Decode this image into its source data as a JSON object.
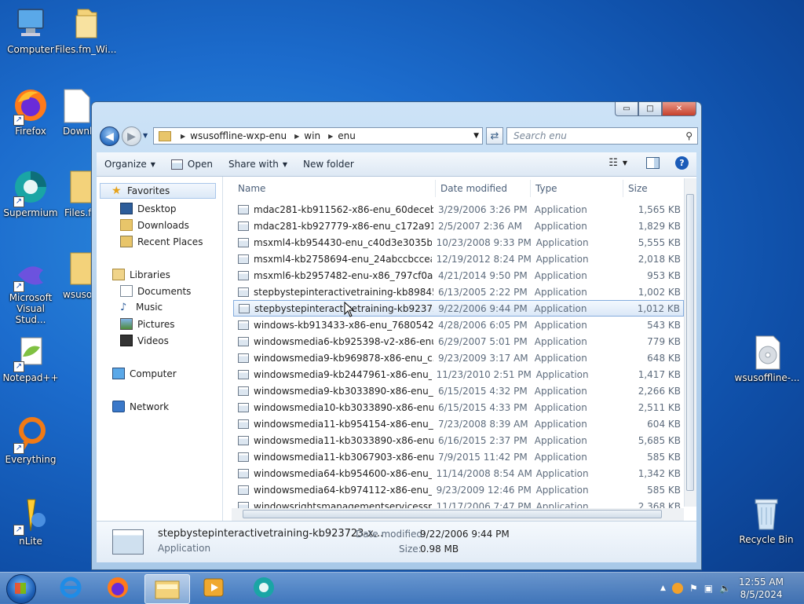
{
  "desktop": {
    "icons": [
      {
        "label": "Computer"
      },
      {
        "label": "Files.fm_Wi..."
      },
      {
        "label": "Firefox"
      },
      {
        "label": "Downl"
      },
      {
        "label": "Supermium"
      },
      {
        "label": "Files.fr"
      },
      {
        "label": "Microsoft Visual Stud..."
      },
      {
        "label": "wsuso"
      },
      {
        "label": "Notepad++"
      },
      {
        "label": "Everything"
      },
      {
        "label": "nLite"
      },
      {
        "label": "wsusoffline-..."
      },
      {
        "label": "Recycle Bin"
      }
    ]
  },
  "window": {
    "caption": {
      "minimize": "▭",
      "maximize": "□",
      "close": "✕"
    },
    "address": {
      "crumbs": [
        "wsusoffline-wxp-enu",
        "win",
        "enu"
      ]
    },
    "search": {
      "placeholder": "Search enu"
    },
    "toolbar": {
      "organize": "Organize",
      "open": "Open",
      "share_with": "Share with",
      "new_folder": "New folder"
    },
    "nav": {
      "favorites": "Favorites",
      "favorites_items": [
        "Desktop",
        "Downloads",
        "Recent Places"
      ],
      "libraries": "Libraries",
      "libraries_items": [
        "Documents",
        "Music",
        "Pictures",
        "Videos"
      ],
      "computer": "Computer",
      "network": "Network"
    },
    "columns": {
      "name": "Name",
      "date": "Date modified",
      "type": "Type",
      "size": "Size"
    },
    "files": [
      {
        "name": "mdac281-kb911562-x86-enu_60deceb348...",
        "date": "3/29/2006 3:26 PM",
        "type": "Application",
        "size": "1,565 KB"
      },
      {
        "name": "mdac281-kb927779-x86-enu_c172a91d2d...",
        "date": "2/5/2007 2:36 AM",
        "type": "Application",
        "size": "1,829 KB"
      },
      {
        "name": "msxml4-kb954430-enu_c40d3e3035b8cea...",
        "date": "10/23/2008 9:33 PM",
        "type": "Application",
        "size": "5,555 KB"
      },
      {
        "name": "msxml4-kb2758694-enu_24abccbcceaf5b...",
        "date": "12/19/2012 8:24 PM",
        "type": "Application",
        "size": "2,018 KB"
      },
      {
        "name": "msxml6-kb2957482-enu-x86_797cf0a8db...",
        "date": "4/21/2014 9:50 PM",
        "type": "Application",
        "size": "953 KB"
      },
      {
        "name": "stepbystepinteractivetraining-kb898458-x...",
        "date": "6/13/2005 2:22 PM",
        "type": "Application",
        "size": "1,002 KB"
      },
      {
        "name": "stepbystepinteractivetraining-kb923723-x...",
        "date": "9/22/2006 9:44 PM",
        "type": "Application",
        "size": "1,012 KB",
        "selected": true
      },
      {
        "name": "windows-kb913433-x86-enu_76805425ec...",
        "date": "4/28/2006 6:05 PM",
        "type": "Application",
        "size": "543 KB"
      },
      {
        "name": "windowsmedia6-kb925398-v2-x86-enu_c...",
        "date": "6/29/2007 5:01 PM",
        "type": "Application",
        "size": "779 KB"
      },
      {
        "name": "windowsmedia9-kb969878-x86-enu_c512...",
        "date": "9/23/2009 3:17 AM",
        "type": "Application",
        "size": "648 KB"
      },
      {
        "name": "windowsmedia9-kb2447961-x86-enu_4d...",
        "date": "11/23/2010 2:51 PM",
        "type": "Application",
        "size": "1,417 KB"
      },
      {
        "name": "windowsmedia9-kb3033890-x86-enu_cd5...",
        "date": "6/15/2015 4:32 PM",
        "type": "Application",
        "size": "2,266 KB"
      },
      {
        "name": "windowsmedia10-kb3033890-x86-enu_ef...",
        "date": "6/15/2015 4:33 PM",
        "type": "Application",
        "size": "2,511 KB"
      },
      {
        "name": "windowsmedia11-kb954154-x86-enu_9b7...",
        "date": "7/23/2008 8:39 AM",
        "type": "Application",
        "size": "604 KB"
      },
      {
        "name": "windowsmedia11-kb3033890-x86-enu_3d...",
        "date": "6/16/2015 2:37 PM",
        "type": "Application",
        "size": "5,685 KB"
      },
      {
        "name": "windowsmedia11-kb3067903-x86-enu_21...",
        "date": "7/9/2015 11:42 PM",
        "type": "Application",
        "size": "585 KB"
      },
      {
        "name": "windowsmedia64-kb954600-x86-enu_3b3...",
        "date": "11/14/2008 8:54 AM",
        "type": "Application",
        "size": "1,342 KB"
      },
      {
        "name": "windowsmedia64-kb974112-x86-enu_da6...",
        "date": "9/23/2009 12:46 PM",
        "type": "Application",
        "size": "585 KB"
      },
      {
        "name": "windowsrightsmanagementservicessp2-...",
        "date": "11/17/2006 7:47 PM",
        "type": "Application",
        "size": "2,368 KB"
      }
    ],
    "details": {
      "name": "stepbystepinteractivetraining-kb923723-x...",
      "type": "Application",
      "date_label": "Date modified:",
      "date_value": "9/22/2006 9:44 PM",
      "size_label": "Size:",
      "size_value": "0.98 MB"
    }
  },
  "taskbar": {
    "clock": {
      "time": "12:55 AM",
      "date": "8/5/2024"
    }
  }
}
